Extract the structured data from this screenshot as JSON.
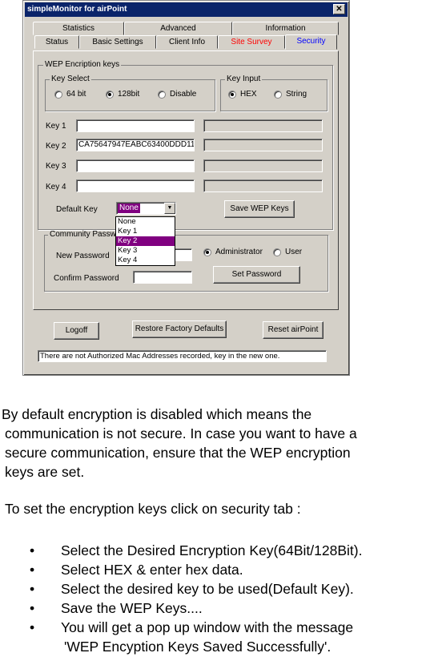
{
  "window": {
    "title": "simpleMonitor for airPoint",
    "close_glyph": "✕"
  },
  "tabs_back": [
    {
      "label": "Statistics"
    },
    {
      "label": "Advanced"
    },
    {
      "label": "Information"
    }
  ],
  "tabs_front": [
    {
      "label": "Status"
    },
    {
      "label": "Basic Settings"
    },
    {
      "label": "Client Info"
    },
    {
      "label": "Site Survey",
      "color": "#ff0000"
    },
    {
      "label": "Security",
      "color": "#0000ff"
    }
  ],
  "wep": {
    "group_label": "WEP Encription keys",
    "key_select": {
      "label": "Key Select",
      "options": [
        "64 bit",
        "128bit",
        "Disable"
      ],
      "selected": "128bit"
    },
    "key_input": {
      "label": "Key Input",
      "options": [
        "HEX",
        "String"
      ],
      "selected": "HEX"
    },
    "keys": [
      {
        "label": "Key 1",
        "value": ""
      },
      {
        "label": "Key 2",
        "value": "CA75647947EABC63400DDD11"
      },
      {
        "label": "Key 3",
        "value": ""
      },
      {
        "label": "Key 4",
        "value": ""
      }
    ],
    "default_key_label": "Default Key",
    "default_key_value": "None",
    "dropdown_options": [
      "None",
      "Key 1",
      "Key 2",
      "Key 3",
      "Key 4"
    ],
    "dropdown_highlight": "Key 2",
    "save_button": "Save WEP Keys"
  },
  "community": {
    "group_label": "Community Password",
    "new_password_label": "New Password",
    "confirm_password_label": "Confirm Password",
    "roles": [
      "Administrator",
      "User"
    ],
    "selected_role": "Administrator",
    "set_button": "Set Password"
  },
  "footer_buttons": {
    "logoff": "Logoff",
    "restore": "Restore Factory Defaults",
    "reset": "Reset airPoint"
  },
  "status_message": "There are not Authorized Mac Addresses recorded, key in the new one.",
  "doc": {
    "para1": [
      "By default encryption is disabled which means the",
      "communication is not secure. In case you want to have a",
      "secure communication, ensure that the WEP encryption",
      "keys are set."
    ],
    "para2": "To set the encryption keys click on security tab :",
    "bullet_glyph": "•",
    "bullets": [
      "Select the Desired Encryption Key(64Bit/128Bit).",
      "Select HEX & enter hex data.",
      "Select the desired key to be used(Default Key).",
      "Save the WEP Keys....",
      "You will get a pop up window with the message"
    ],
    "bullet5_cont": "'WEP Encyption Keys Saved Successfully'."
  }
}
